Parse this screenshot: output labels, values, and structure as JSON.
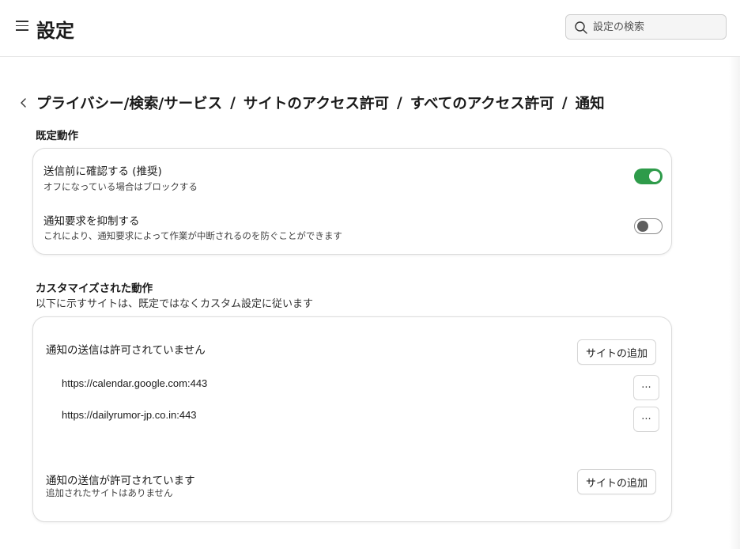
{
  "header": {
    "title": "設定",
    "search_placeholder": "設定の検索"
  },
  "breadcrumb": [
    "プライバシー/検索/サービス",
    "サイトのアクセス許可",
    "すべてのアクセス許可",
    "通知"
  ],
  "breadcrumb_separator": "/",
  "default_behavior": {
    "heading": "既定動作",
    "rows": [
      {
        "title": "送信前に確認する (推奨)",
        "description": "オフになっている場合はブロックする",
        "enabled": true
      },
      {
        "title": "通知要求を抑制する",
        "description": "これにより、通知要求によって作業が中断されるのを防ぐことができます",
        "enabled": false
      }
    ]
  },
  "custom_behavior": {
    "heading": "カスタマイズされた動作",
    "subheading": "以下に示すサイトは、既定ではなくカスタム設定に従います",
    "blocked": {
      "title": "通知の送信は許可されていません",
      "add_label": "サイトの追加",
      "sites": [
        "https://calendar.google.com:443",
        "https://dailyrumor-jp.co.in:443"
      ],
      "more_label": "···"
    },
    "allowed": {
      "title": "通知の送信が許可されています",
      "empty_text": "追加されたサイトはありません",
      "add_label": "サイトの追加"
    }
  },
  "colors": {
    "toggle_on": "#2e9b4a",
    "accent": "#2e9b4a"
  },
  "icons": [
    "menu-icon",
    "search-icon",
    "back-chevron-icon"
  ]
}
